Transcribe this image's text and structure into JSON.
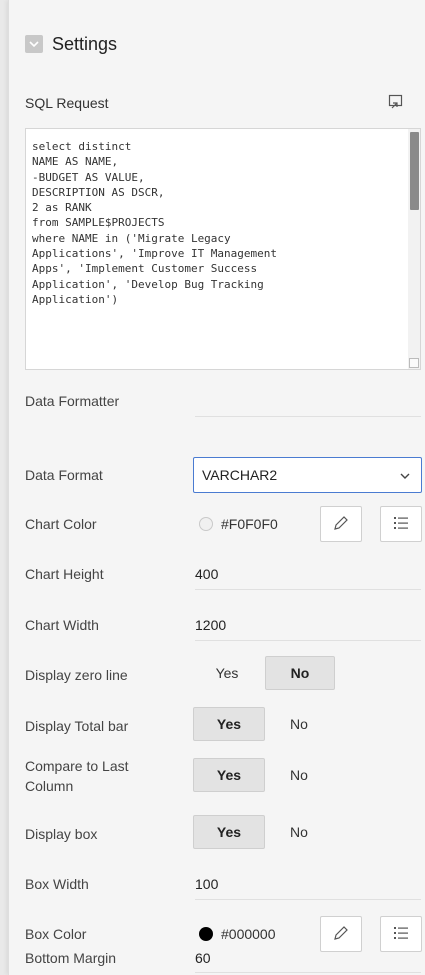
{
  "header": {
    "title": "Settings",
    "collapse_icon": "minus-square-icon"
  },
  "sql": {
    "label": "SQL Request",
    "expand_icon": "expand-icon",
    "text": "select distinct\nNAME AS NAME,\n-BUDGET AS VALUE,\nDESCRIPTION AS DSCR,\n2 as RANK\nfrom SAMPLE$PROJECTS\nwhere NAME in ('Migrate Legacy\nApplications', 'Improve IT Management\nApps', 'Implement Customer Success\nApplication', 'Develop Bug Tracking\nApplication')"
  },
  "data_formatter": {
    "label": "Data Formatter",
    "value": ""
  },
  "data_format": {
    "label": "Data Format",
    "value": "VARCHAR2"
  },
  "chart_color": {
    "label": "Chart Color",
    "value": "#F0F0F0",
    "swatch": "#F0F0F0"
  },
  "chart_height": {
    "label": "Chart Height",
    "value": "400"
  },
  "chart_width": {
    "label": "Chart Width",
    "value": "1200"
  },
  "display_zero_line": {
    "label": "Display zero line",
    "yes": "Yes",
    "no": "No",
    "selected": "No"
  },
  "display_total_bar": {
    "label": "Display Total bar",
    "yes": "Yes",
    "no": "No",
    "selected": "Yes"
  },
  "compare_last_column": {
    "label_line1": "Compare to Last",
    "label_line2": "Column",
    "yes": "Yes",
    "no": "No",
    "selected": "Yes"
  },
  "display_box": {
    "label": "Display box",
    "yes": "Yes",
    "no": "No",
    "selected": "Yes"
  },
  "box_width": {
    "label": "Box Width",
    "value": "100"
  },
  "box_color": {
    "label": "Box Color",
    "value": "#000000",
    "swatch": "#000000"
  },
  "bottom_margin": {
    "label": "Bottom Margin",
    "value": "60"
  }
}
